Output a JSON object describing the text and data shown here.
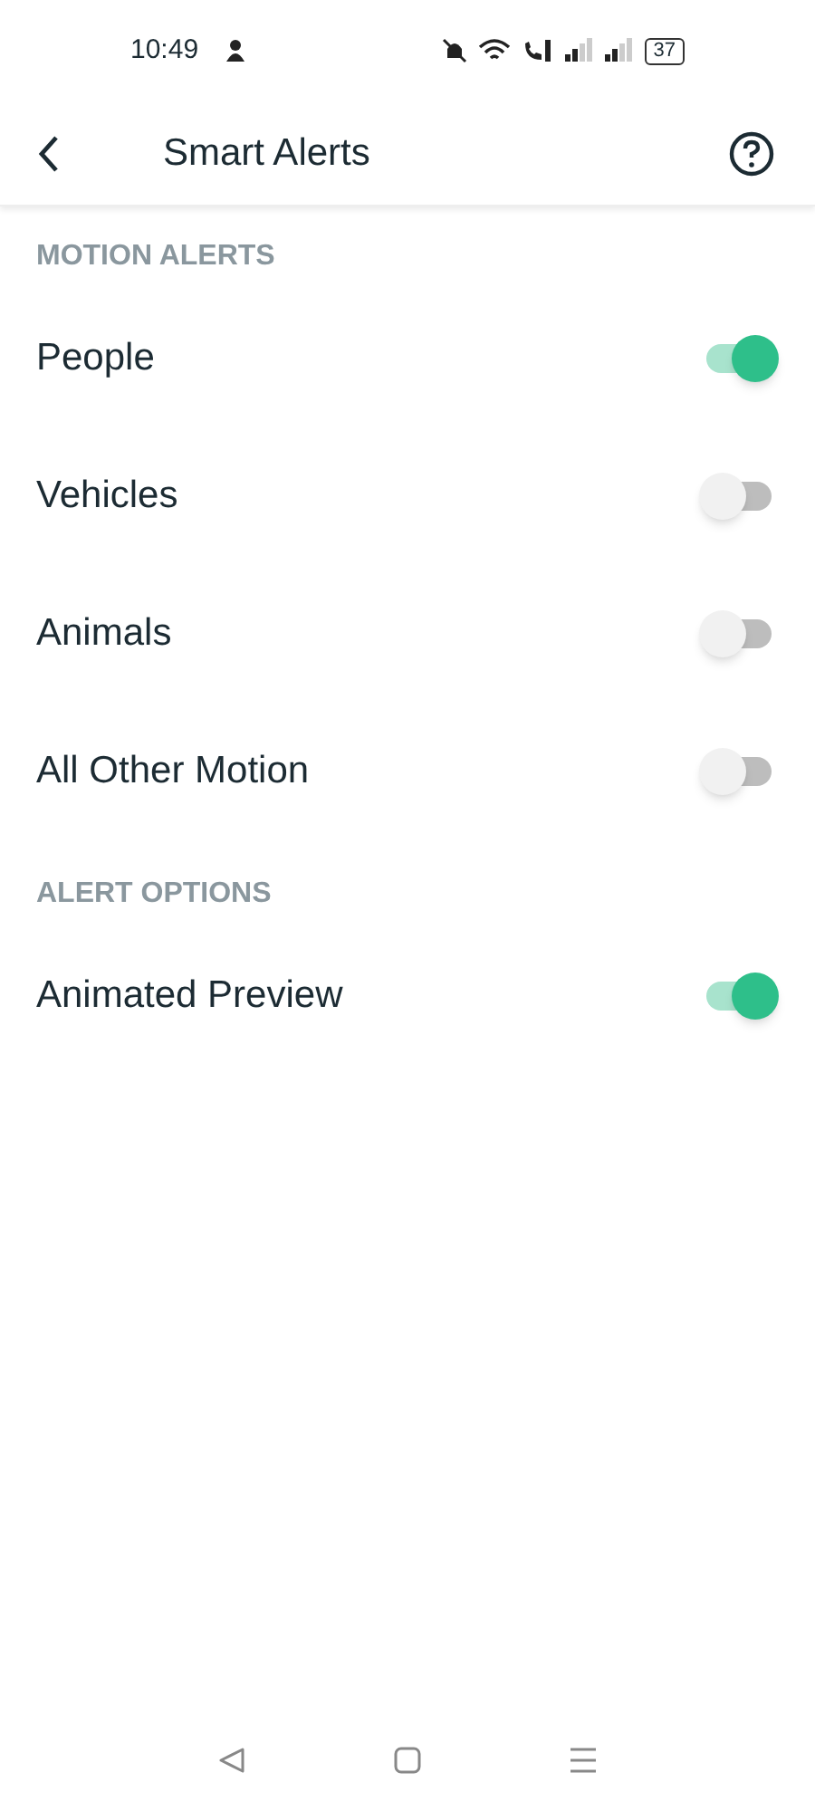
{
  "status_bar": {
    "time": "10:49",
    "battery": "37"
  },
  "header": {
    "title": "Smart Alerts"
  },
  "sections": [
    {
      "title": "MOTION ALERTS",
      "items": [
        {
          "label": "People",
          "on": true
        },
        {
          "label": "Vehicles",
          "on": false
        },
        {
          "label": "Animals",
          "on": false
        },
        {
          "label": "All Other Motion",
          "on": false
        }
      ]
    },
    {
      "title": "ALERT OPTIONS",
      "items": [
        {
          "label": "Animated Preview",
          "on": true
        }
      ]
    }
  ]
}
